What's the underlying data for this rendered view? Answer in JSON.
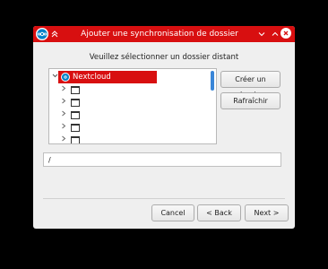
{
  "window": {
    "title": "Ajouter une synchronisation de dossier",
    "pin_icon": "pin-icon",
    "minimize_icon": "chevron-down-icon",
    "maximize_icon": "chevron-up-icon",
    "close_icon": "close-icon",
    "title_color": "#d80f10"
  },
  "prompt": "Veuillez sélectionner un dossier distant",
  "tree": {
    "root": {
      "label": "Nextcloud",
      "expanded": true,
      "icon": "nextcloud-icon"
    },
    "children": [
      {
        "label": "",
        "icon": "folder-icon"
      },
      {
        "label": "",
        "icon": "folder-icon"
      },
      {
        "label": "",
        "icon": "folder-icon"
      },
      {
        "label": "",
        "icon": "folder-icon"
      },
      {
        "label": "",
        "icon": "folder-icon"
      }
    ]
  },
  "buttons": {
    "create_folder": "Créer un dossier",
    "refresh": "Rafraîchir",
    "cancel": "Cancel",
    "back": "< Back",
    "next": "Next >"
  },
  "path_field": {
    "value": "/"
  }
}
